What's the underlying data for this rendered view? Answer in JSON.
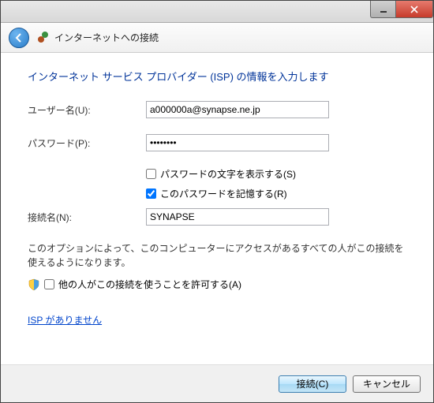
{
  "header": {
    "title": "インターネットへの接続"
  },
  "content": {
    "instruction": "インターネット サービス プロバイダー (ISP) の情報を入力します",
    "username_label": "ユーザー名(U):",
    "username_value": "a000000a@synapse.ne.jp",
    "password_label": "パスワード(P):",
    "password_value": "••••••••",
    "show_password_label": "パスワードの文字を表示する(S)",
    "remember_password_label": "このパスワードを記憶する(R)",
    "connection_name_label": "接続名(N):",
    "connection_name_value": "SYNAPSE",
    "description": "このオプションによって、このコンピューターにアクセスがあるすべての人がこの接続を使えるようになります。",
    "allow_others_label": "他の人がこの接続を使うことを許可する(A)",
    "no_isp_link": "ISP がありません"
  },
  "footer": {
    "connect_button": "接続(C)",
    "cancel_button": "キャンセル"
  }
}
